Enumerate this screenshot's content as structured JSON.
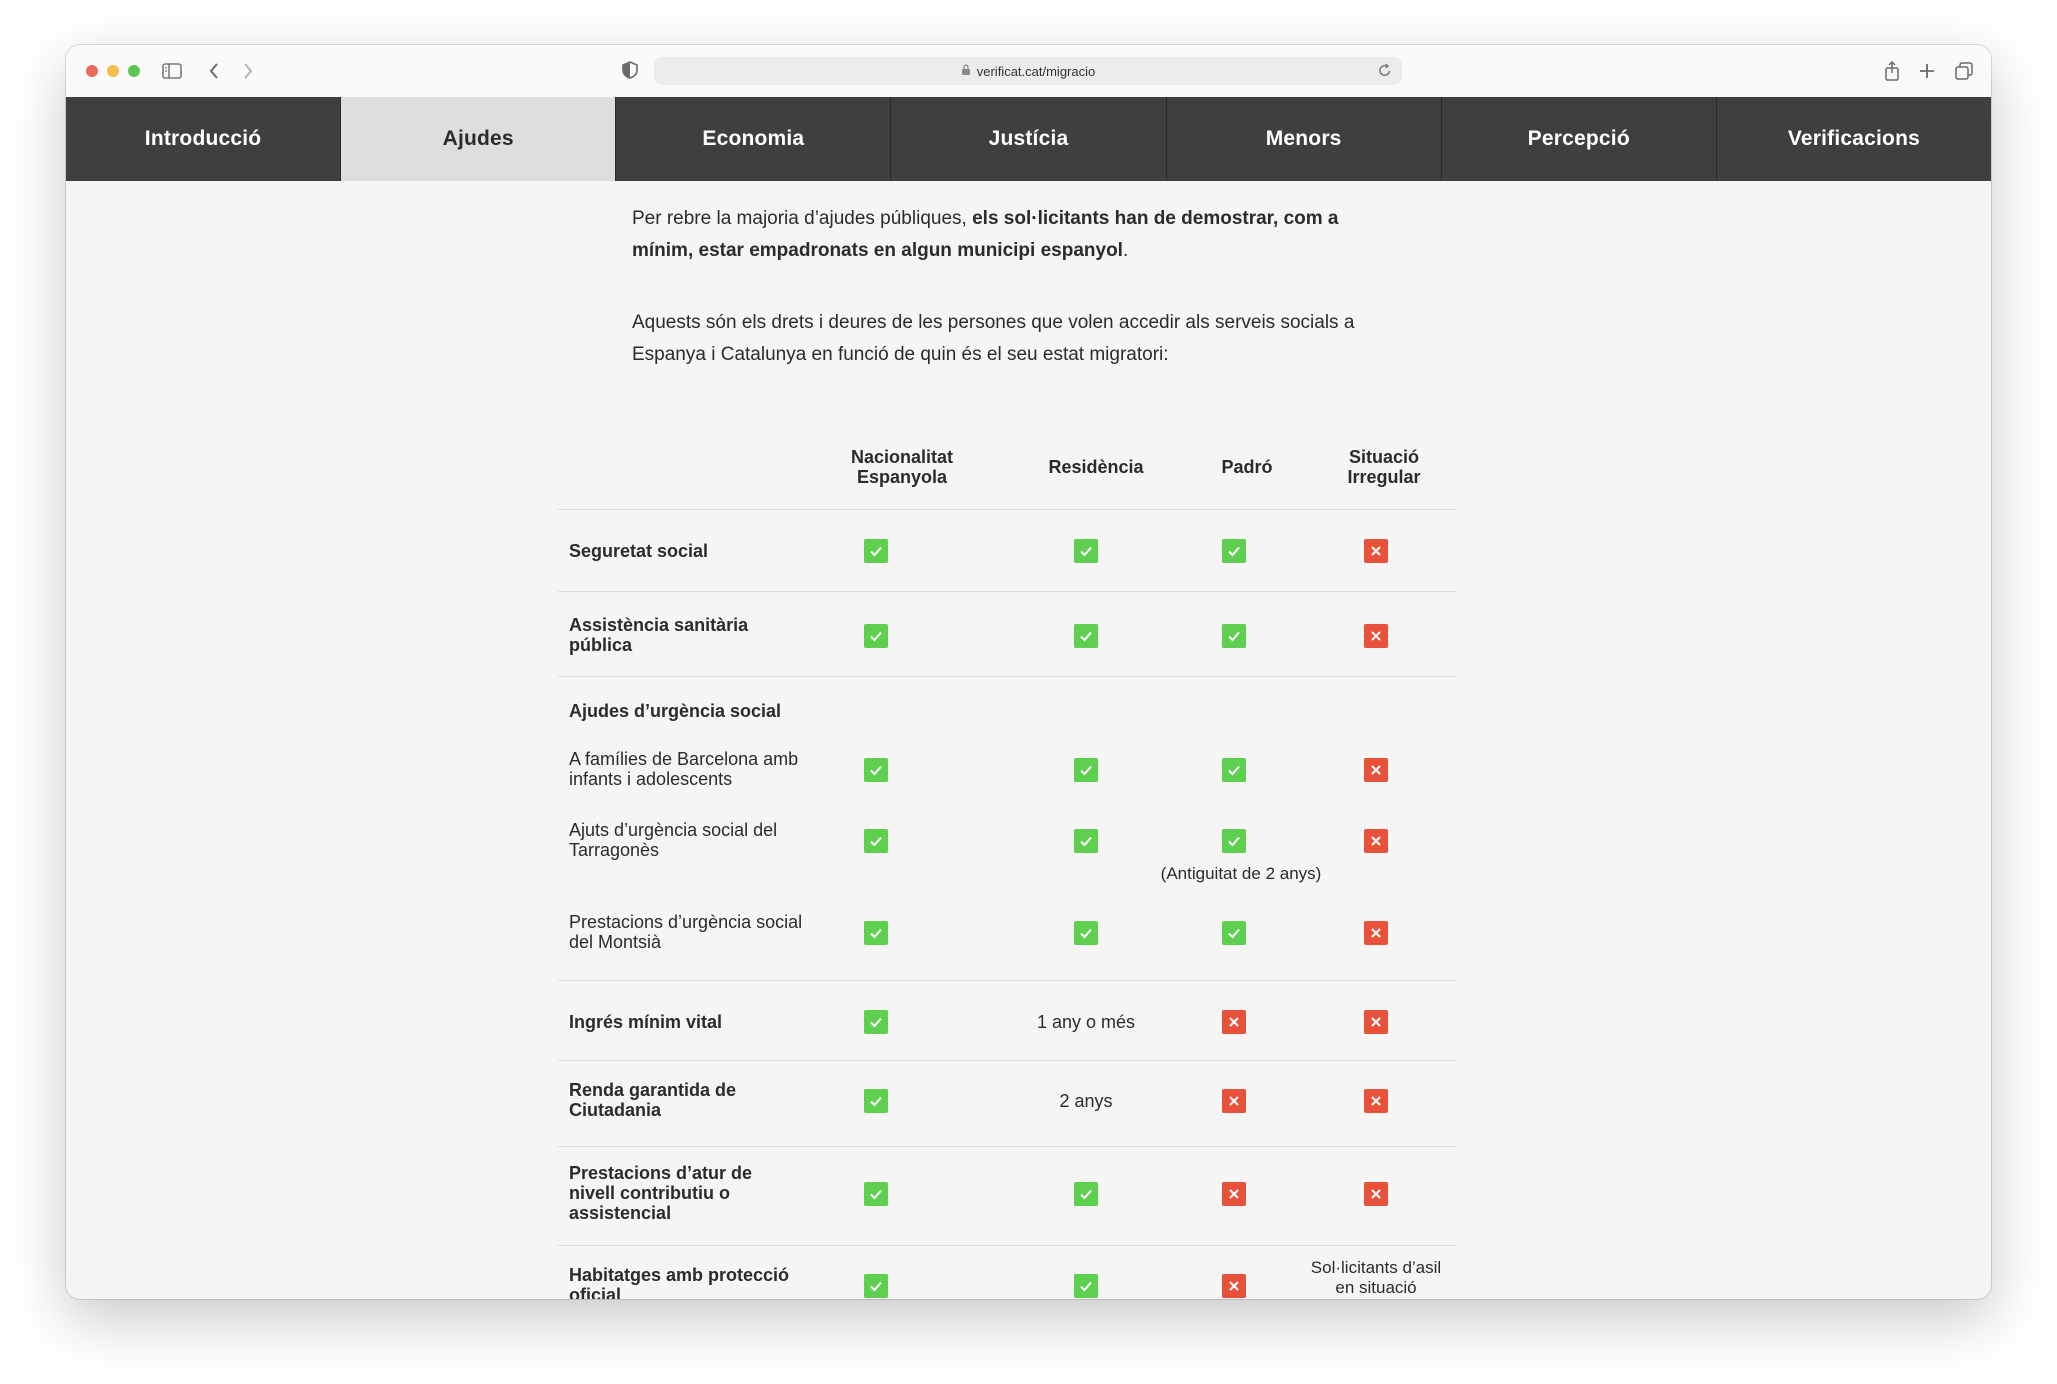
{
  "browser": {
    "url": "verificat.cat/migracio"
  },
  "nav": {
    "tabs": [
      {
        "label": "Introducció",
        "active": false
      },
      {
        "label": "Ajudes",
        "active": true
      },
      {
        "label": "Economia",
        "active": false
      },
      {
        "label": "Justícia",
        "active": false
      },
      {
        "label": "Menors",
        "active": false
      },
      {
        "label": "Percepció",
        "active": false
      },
      {
        "label": "Verificacions",
        "active": false
      }
    ]
  },
  "intro": {
    "p1_start": "Per rebre la majoria d’ajudes públiques, ",
    "p1_bold": "els sol·licitants han de demostrar, com a mínim, estar empadronats en algun municipi espanyol",
    "p1_end": ".",
    "p2": "Aquests són els drets i deures de les persones que volen accedir als serveis socials a Espanya i Catalunya en funció de quin és el seu estat migratori:"
  },
  "table": {
    "columns": [
      "Nacionalitat Espanyola",
      "Residència",
      "Padró",
      "Situació Irregular"
    ],
    "colors": {
      "yes": "#5fcf4f",
      "no": "#e8513a"
    },
    "rows": [
      {
        "label": "Seguretat social",
        "cells": [
          "yes",
          "yes",
          "yes",
          "no"
        ]
      },
      {
        "label": "Assistència sanitària pública",
        "cells": [
          "yes",
          "yes",
          "yes",
          "no"
        ]
      },
      {
        "group": "Ajudes d’urgència social"
      },
      {
        "label": "A famílies de Barcelona amb infants i adolescents",
        "cells": [
          "yes",
          "yes",
          "yes",
          "no"
        ]
      },
      {
        "label": "Ajuts d’urgència social del Tarragonès",
        "cells": [
          "yes",
          "yes",
          "yes",
          "no"
        ],
        "note": "(Antiguitat de 2 anys)"
      },
      {
        "label": "Prestacions d’urgència social del Montsià",
        "cells": [
          "yes",
          "yes",
          "yes",
          "no"
        ]
      },
      {
        "label": "Ingrés mínim vital",
        "cells": [
          "yes",
          "1 any o més",
          "no",
          "no"
        ]
      },
      {
        "label": "Renda garantida de Ciutadania",
        "cells": [
          "yes",
          "2 anys",
          "no",
          "no"
        ]
      },
      {
        "label": "Prestacions d’atur de nivell contributiu o assistencial",
        "cells": [
          "yes",
          "yes",
          "no",
          "no"
        ]
      },
      {
        "label": "Habitatges amb protecció oficial",
        "cells": [
          "yes",
          "yes",
          "no",
          "Sol·licitants d’asil en situació"
        ]
      }
    ]
  }
}
